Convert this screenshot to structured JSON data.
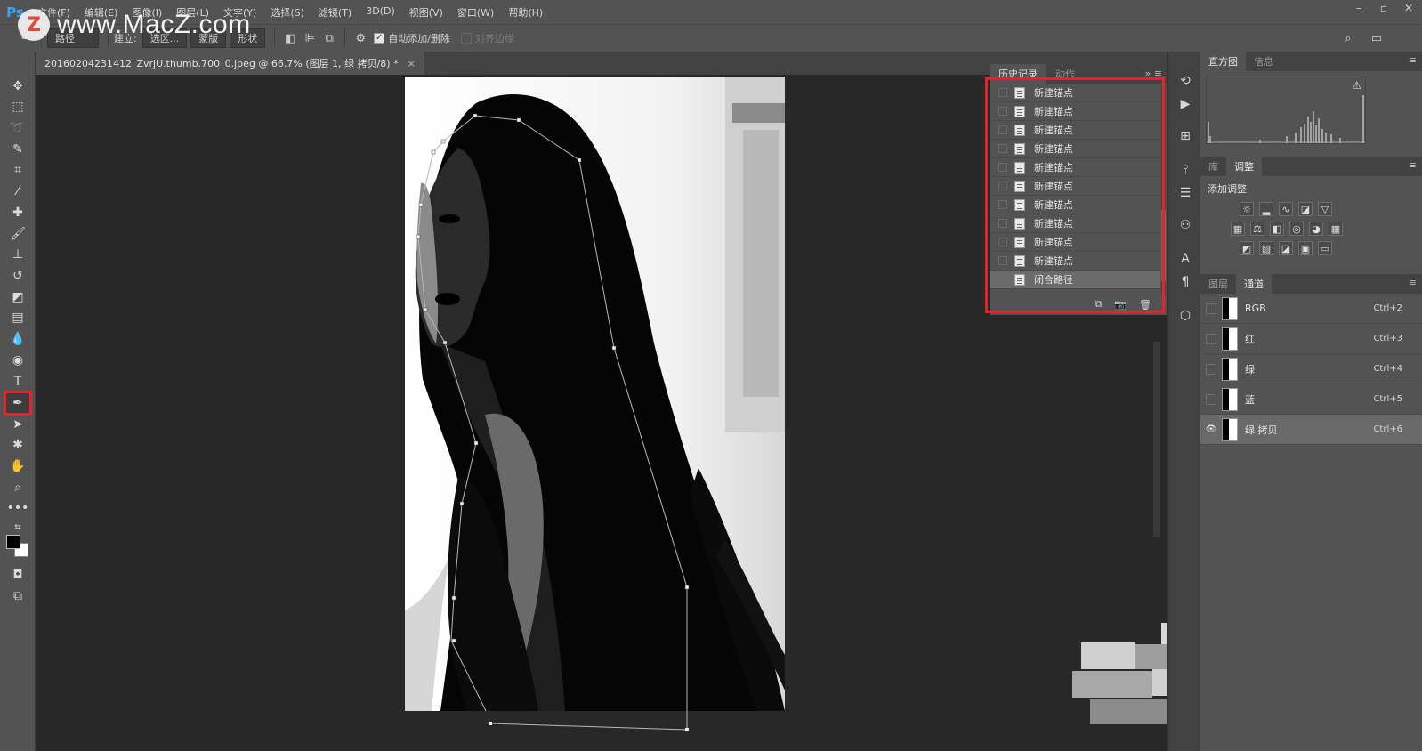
{
  "app": {
    "logo": "Ps"
  },
  "watermark": {
    "logo_letter": "Z",
    "text": "www.MacZ.com"
  },
  "menu": [
    "文件(F)",
    "编辑(E)",
    "图像(I)",
    "图层(L)",
    "文字(Y)",
    "选择(S)",
    "滤镜(T)",
    "3D(D)",
    "视图(V)",
    "窗口(W)",
    "帮助(H)"
  ],
  "window_controls": {
    "minimize": "–",
    "restore": "▫",
    "close": "✕"
  },
  "options": {
    "mode": "路径",
    "make_label": "建立:",
    "selection_btn": "选区...",
    "mask_btn": "蒙版",
    "shape_btn": "形状",
    "auto_add_delete": "自动添加/删除",
    "auto_add_checked": true,
    "align_edges": "对齐边缘",
    "align_edges_checked": false
  },
  "document": {
    "tab_title": "20160204231412_ZvrjU.thumb.700_0.jpeg @ 66.7% (图层 1, 绿 拷贝/8) *",
    "close": "×"
  },
  "history_panel": {
    "tabs": [
      "历史记录",
      "动作"
    ],
    "active_tab": 0,
    "items": [
      "新建锚点",
      "新建锚点",
      "新建锚点",
      "新建锚点",
      "新建锚点",
      "新建锚点",
      "新建锚点",
      "新建锚点",
      "新建锚点",
      "新建锚点",
      "闭合路径"
    ],
    "selected_index": 10,
    "highlight_color": "#e2252b"
  },
  "histogram_panel": {
    "tabs": [
      "直方图",
      "信息"
    ],
    "active_tab": 0,
    "warning_icon": "⚠"
  },
  "adjustments_panel": {
    "tabs": [
      "库",
      "调整"
    ],
    "active_tab": 1,
    "title": "添加调整"
  },
  "channels_panel": {
    "tabs": [
      "图层",
      "通道"
    ],
    "active_tab": 1,
    "channels": [
      {
        "name": "RGB",
        "shortcut": "Ctrl+2",
        "visible": false
      },
      {
        "name": "红",
        "shortcut": "Ctrl+3",
        "visible": false
      },
      {
        "name": "绿",
        "shortcut": "Ctrl+4",
        "visible": false
      },
      {
        "name": "蓝",
        "shortcut": "Ctrl+5",
        "visible": false
      },
      {
        "name": "绿 拷贝",
        "shortcut": "Ctrl+6",
        "visible": true
      }
    ],
    "selected_index": 4
  },
  "colors": {
    "ui_bg": "#535353",
    "dark_bg": "#282828",
    "accent_red": "#e2252b",
    "ps_blue": "#31a8ff"
  }
}
